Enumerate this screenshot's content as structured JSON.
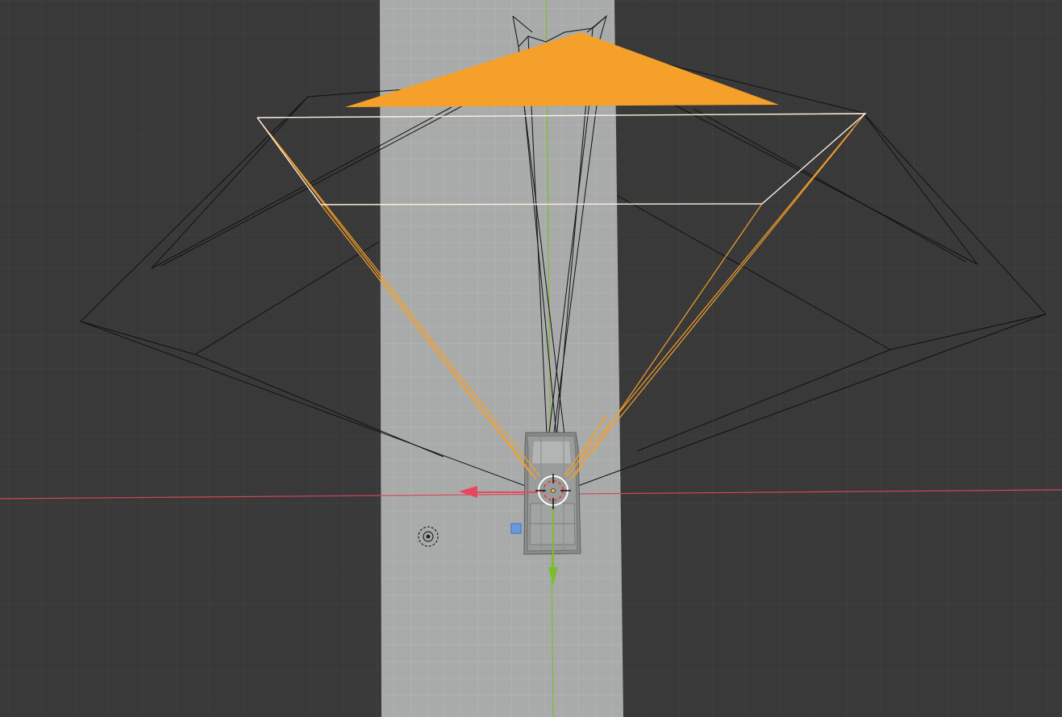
{
  "viewport": {
    "background_color": "#393939",
    "grid_color": "#444444",
    "plane_color": "#a9abab",
    "plane_grid_color": "#b7b9b9",
    "x_axis_color": "#d4465a",
    "y_axis_color": "#7cbd2d",
    "selection_color": "#f5a02a",
    "active_edge_color": "#fff1e0",
    "wire_color": "#111111",
    "origin_handle_color": "#5b95e6"
  },
  "objects": {
    "active_camera": {
      "name": "camera",
      "selected": true,
      "icon": "camera-frustum-icon"
    },
    "inactive_cameras": [
      {
        "icon": "camera-frustum-icon"
      },
      {
        "icon": "camera-frustum-icon"
      }
    ],
    "vehicle": {
      "icon": "vehicle-mesh-icon"
    },
    "light": {
      "icon": "point-light-icon"
    }
  },
  "gizmos": {
    "move_x_arrow": {
      "icon": "arrow-left-icon",
      "color": "#e8485e"
    },
    "move_y_arrow": {
      "icon": "arrow-down-icon",
      "color": "#7cbd2d"
    },
    "origin_handle": {
      "icon": "square-handle-icon"
    },
    "cursor_3d": {
      "icon": "crosshair-cursor-icon"
    }
  }
}
